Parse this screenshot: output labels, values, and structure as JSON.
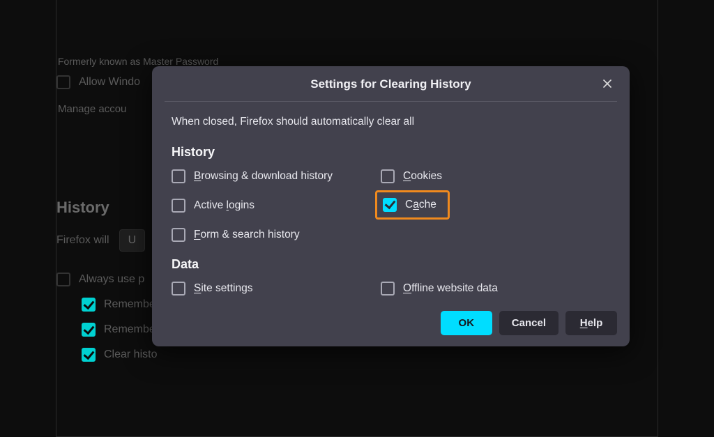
{
  "bg": {
    "formerly": "Formerly known as Master Password",
    "allow_windows": "Allow Windo",
    "manage": "Manage accou",
    "history_heading": "History",
    "firefox_will": "Firefox will",
    "select_value": "U",
    "always_private": "Always use p",
    "remember1": "Remembe",
    "remember2": "Remembe",
    "clear_history": "Clear histo"
  },
  "modal": {
    "title": "Settings for Clearing History",
    "intro": "When closed, Firefox should automatically clear all",
    "section_history": "History",
    "section_data": "Data",
    "options": {
      "browsing": {
        "pre": "",
        "u": "B",
        "post": "rowsing & download history",
        "checked": false
      },
      "cookies": {
        "pre": "",
        "u": "C",
        "post": "ookies",
        "checked": false
      },
      "active": {
        "pre": "Active ",
        "u": "l",
        "post": "ogins",
        "checked": false
      },
      "cache": {
        "pre": "C",
        "u": "a",
        "post": "che",
        "checked": true
      },
      "form": {
        "pre": "",
        "u": "F",
        "post": "orm & search history",
        "checked": false
      },
      "site": {
        "pre": "",
        "u": "S",
        "post": "ite settings",
        "checked": false
      },
      "offline": {
        "pre": "",
        "u": "O",
        "post": "ffline website data",
        "checked": false
      }
    },
    "buttons": {
      "ok": "OK",
      "cancel": "Cancel",
      "help": {
        "u": "H",
        "post": "elp"
      }
    }
  }
}
